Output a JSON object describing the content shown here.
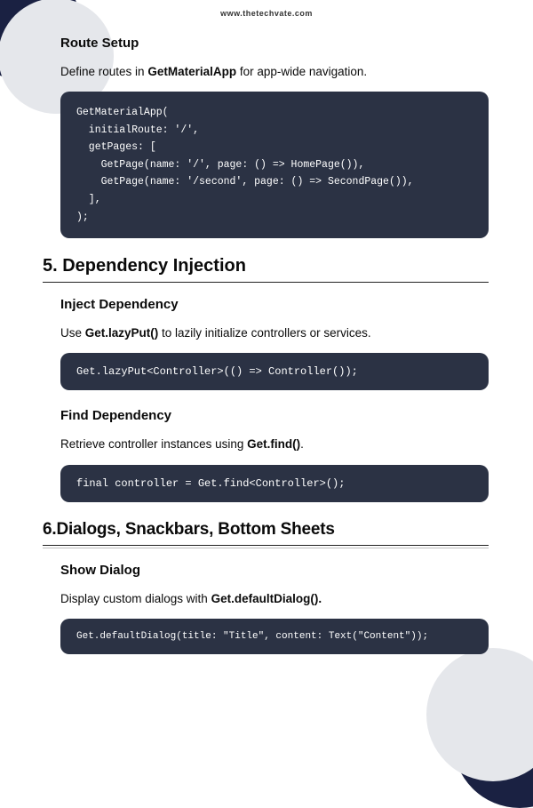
{
  "site_url": "www.thetechvate.com",
  "sections": {
    "route_setup": {
      "title": "Route Setup",
      "para_pre": "Define routes in ",
      "para_bold": "GetMaterialApp",
      "para_post": " for app-wide navigation.",
      "code": "GetMaterialApp(\n  initialRoute: '/',\n  getPages: [\n    GetPage(name: '/', page: () => HomePage()),\n    GetPage(name: '/second', page: () => SecondPage()),\n  ],\n);"
    },
    "section5": {
      "title": "5. Dependency Injection",
      "inject": {
        "title": "Inject Dependency",
        "para_pre": "Use ",
        "para_bold": "Get.lazyPut()",
        "para_post": " to lazily initialize controllers or services.",
        "code": "Get.lazyPut<Controller>(() => Controller());"
      },
      "find": {
        "title": "Find Dependency",
        "para_pre": "Retrieve controller instances using ",
        "para_bold": "Get.find()",
        "para_post": ".",
        "code": "final controller = Get.find<Controller>();"
      }
    },
    "section6": {
      "title": "6.Dialogs, Snackbars, Bottom Sheets",
      "show_dialog": {
        "title": "Show Dialog",
        "para_pre": "Display custom dialogs with ",
        "para_bold": "Get.defaultDialog().",
        "code": "Get.defaultDialog(title: \"Title\", content: Text(\"Content\"));"
      }
    }
  }
}
